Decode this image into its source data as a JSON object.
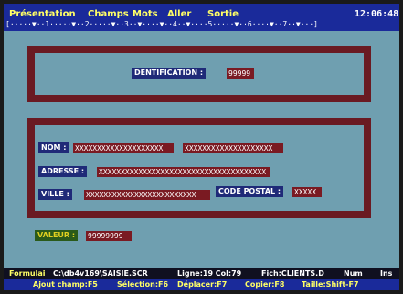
{
  "menu": {
    "items": [
      "Présentation",
      "Champs",
      "Mots",
      "Aller",
      "Sortie"
    ],
    "clock": "12:06:48"
  },
  "ruler": {
    "numbers": [
      "1",
      "2",
      "3",
      "4",
      "5",
      "6",
      "7"
    ]
  },
  "form": {
    "identification": {
      "label": "DENTIFICATION :",
      "value": "99999"
    },
    "nom": {
      "label": "NOM :",
      "value1": "XXXXXXXXXXXXXXXXXXXX",
      "value2": "XXXXXXXXXXXXXXXXXXXX"
    },
    "adresse": {
      "label": "ADRESSE :",
      "value": "XXXXXXXXXXXXXXXXXXXXXXXXXXXXXXXXXXXXXX"
    },
    "ville": {
      "label": "VILLE :",
      "value": "XXXXXXXXXXXXXXXXXXXXXXXXX"
    },
    "code_postal": {
      "label": "CODE POSTAL :",
      "value": "XXXXX"
    },
    "valeur": {
      "label": "VALEUR :",
      "value": "99999999"
    }
  },
  "status": {
    "mode": "Formulai",
    "path": "C:\\db4v169\\SAISIE.SCR",
    "position": "Ligne:19 Col:79",
    "file": "Fich:CLIENTS.D",
    "num": "Num",
    "ins": "Ins"
  },
  "function_keys": {
    "ajout": "Ajout champ:F5",
    "selection": "Sélection:F6",
    "deplacer": "Déplacer:F7",
    "copier": "Copier:F8",
    "taille": "Taille:Shift-F7"
  },
  "colors": {
    "background": "#6f9fb0",
    "menubar": "#1a2a9a",
    "panel_border": "#6a1a22",
    "field": "#7a1a22",
    "label": "#1f2a78"
  }
}
